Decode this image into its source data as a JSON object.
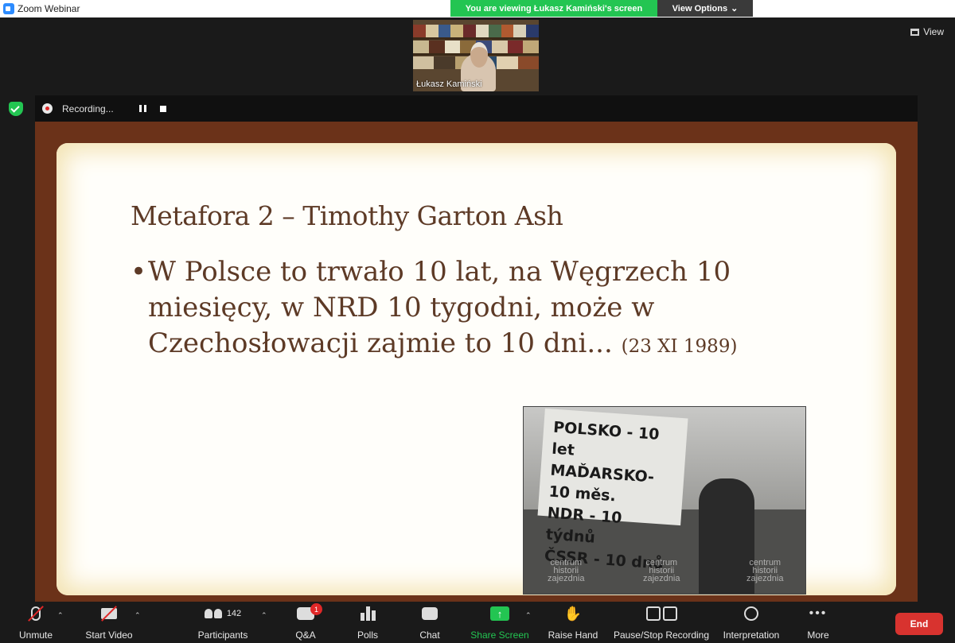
{
  "window": {
    "title": "Zoom Webinar"
  },
  "banner": {
    "message": "You are viewing Łukasz Kamiński's screen",
    "options_label": "View Options",
    "options_caret": "⌄"
  },
  "view_button": {
    "label": "View"
  },
  "speaker": {
    "name": "Łukasz Kamiński"
  },
  "recording": {
    "label": "Recording..."
  },
  "slide": {
    "title": "Metafora 2 – Timothy Garton Ash",
    "bullet_glyph": "•",
    "bullet_text": "W Polsce to trwało 10 lat, na Węgrzech 10 miesięcy, w NRD 10 tygodni, może w Czechosłowacji zajmie to 10 dni...",
    "bullet_date": "(23 XI 1989)",
    "photo": {
      "banner_lines": [
        "POLSKO - 10 let",
        "MAĎARSKO-10 měs.",
        "NDR - 10 týdnů",
        "ČSSR - 10 dnů"
      ],
      "watermark_lines": [
        "centrum",
        "historii",
        "zajezdnia"
      ]
    }
  },
  "toolbar": {
    "unmute": "Unmute",
    "start_video": "Start Video",
    "participants": "Participants",
    "participants_count": "142",
    "qa": "Q&A",
    "qa_badge": "1",
    "polls": "Polls",
    "chat": "Chat",
    "share_screen": "Share Screen",
    "raise_hand": "Raise Hand",
    "pause_stop_recording": "Pause/Stop Recording",
    "interpretation": "Interpretation",
    "more": "More",
    "end": "End",
    "caret": "⌃"
  },
  "colors": {
    "accent_green": "#23c552",
    "end_red": "#d8332f",
    "slide_border": "#6b3219",
    "slide_text": "#5d3a26"
  }
}
